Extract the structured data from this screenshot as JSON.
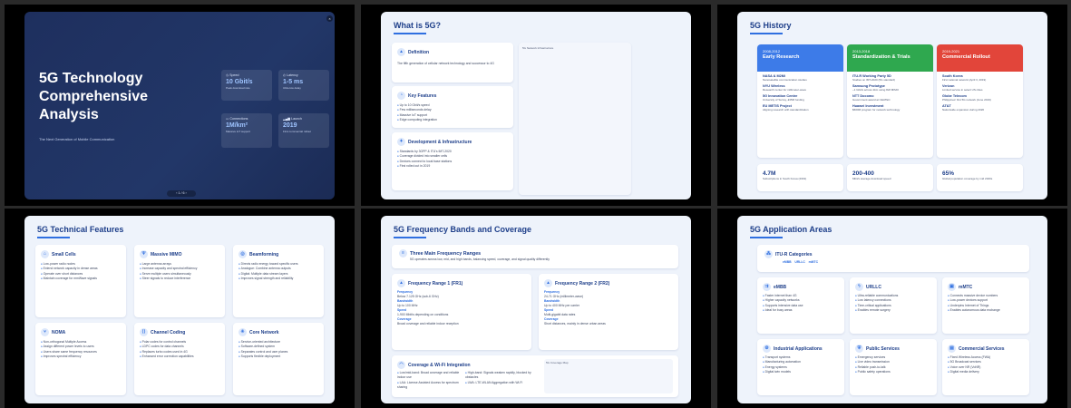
{
  "slides": {
    "s1": {
      "title_l1": "5G Technology",
      "title_l2": "Comprehensive",
      "title_l3": "Analysis",
      "subtitle": "The Next Generation of Mobile Communication",
      "stats": [
        {
          "label": "Speed",
          "value": "10 Gbit/s",
          "desc": "Peak download rate"
        },
        {
          "label": "Latency",
          "value": "1-5 ms",
          "desc": "Ultra-low delay"
        },
        {
          "label": "Connections",
          "value": "1M/km²",
          "desc": "Massive IoT support"
        },
        {
          "label": "Launch",
          "value": "2019",
          "desc": "First commercial rollout"
        }
      ],
      "pager": "1 / 6",
      "close": "×"
    },
    "s2": {
      "title": "What is 5G?",
      "definition_title": "Definition",
      "definition_text": "The fifth generation of cellular network technology and successor to 4G",
      "features_title": "Key Features",
      "features": [
        "Up to 10 Gbit/s speed",
        "Few milliseconds delay",
        "Massive IoT support",
        "Edge computing integration"
      ],
      "dev_title": "Development & Infrastructure",
      "dev_items": [
        "Standards by 3GPP & ITU's IMT-2020",
        "Coverage divided into smaller cells",
        "Devices connect to local base stations",
        "First rolled out in 2019"
      ],
      "image_caption": "5G Network Infrastructure"
    },
    "s3": {
      "title": "5G History",
      "columns": [
        {
          "years": "2008-2012",
          "name": "Early Research",
          "color": "#3d7be8",
          "items": [
            {
              "t": "NASA & M2Mi",
              "d": "Nanosatellite communication studies"
            },
            {
              "t": "NYU Wireless",
              "d": "Research center for millimeter-wave"
            },
            {
              "t": "5G Innovation Centre",
              "d": "University of Surrey, £35M funding"
            },
            {
              "t": "EU METIS Project",
              "d": "Aligning research with standardization"
            }
          ]
        },
        {
          "years": "2013-2018",
          "name": "Standardization & Trials",
          "color": "#2fa84f",
          "items": [
            {
              "t": "ITU-R Working Party 5D",
              "d": "Studies on IMT-2020 (5G standard)"
            },
            {
              "t": "Samsung Prototype",
              "d": "~1 Gbit/s across 2km using 8x8 MIMO"
            },
            {
              "t": "NTT Docomo",
              "d": "Government award at CEATEC"
            },
            {
              "t": "Huawei Investment",
              "d": "$600M program for network technology"
            }
          ]
        },
        {
          "years": "2019-2021",
          "name": "Commercial Rollout",
          "color": "#e2453a",
          "items": [
            {
              "t": "South Korea",
              "d": "First national network (April 3, 2019)"
            },
            {
              "t": "Verizon",
              "d": "Limited service in select US cities"
            },
            {
              "t": "Globe Telecom",
              "d": "Philippines' first 5G network (June 2019)"
            },
            {
              "t": "AT&T",
              "d": "Nationwide expansion during 2020"
            }
          ]
        }
      ],
      "stats": [
        {
          "v": "4.7M",
          "d": "Subscriptions in South Korea (2019)"
        },
        {
          "v": "200-400",
          "d": "Mbit/s average download speed"
        },
        {
          "v": "65%",
          "d": "Global population coverage by mid 2020s"
        }
      ]
    },
    "s4": {
      "title": "5G Technical Features",
      "cards": [
        {
          "t": "Small Cells",
          "items": [
            "Low-power radio nodes",
            "Extend network capacity in dense areas",
            "Operate over short distances",
            "Maintain coverage for mmWave signals"
          ]
        },
        {
          "t": "Massive MIMO",
          "items": [
            "Large antenna arrays",
            "Increase capacity and spectral efficiency",
            "Serve multiple users simultaneously",
            "Steer signals to reduce interference"
          ]
        },
        {
          "t": "Beamforming",
          "items": [
            "Directs radio energy toward specific users",
            "Analogue: Combine antenna outputs",
            "Digital: Multiple data stream layers",
            "Improves signal strength and reliability"
          ]
        },
        {
          "t": "NOMA",
          "items": [
            "Non-orthogonal Multiple Access",
            "Assign different power levels to users",
            "Users share same frequency resources",
            "Improves spectral efficiency"
          ]
        },
        {
          "t": "Channel Coding",
          "items": [
            "Polar codes for control channels",
            "LDPC codes for data channels",
            "Replaces turbo codes used in 4G",
            "Enhanced error correction capabilities"
          ]
        },
        {
          "t": "Core Network",
          "items": [
            "Service-oriented architecture",
            "Software-defined system",
            "Separates control and user planes",
            "Supports flexible deployment"
          ]
        }
      ]
    },
    "s5": {
      "title": "5G Frequency Bands and Coverage",
      "banner_title": "Three Main Frequency Ranges",
      "banner_text": "5G operates across low, mid, and high bands, balancing speed, coverage, and signal quality differently",
      "fr1_title": "Frequency Range 1 (FR1)",
      "fr1": [
        {
          "k": "Frequency",
          "v": "Below 7.125 GHz (sub-6 GHz)"
        },
        {
          "k": "Bandwidth",
          "v": "Up to 100 MHz"
        },
        {
          "k": "Speed",
          "v": "1-900 Mbit/s depending on conditions"
        },
        {
          "k": "Coverage",
          "v": "Broad coverage and reliable indoor reception"
        }
      ],
      "fr2_title": "Frequency Range 2 (FR2)",
      "fr2": [
        {
          "k": "Frequency",
          "v": "24-71 GHz (millimeter-wave)"
        },
        {
          "k": "Bandwidth",
          "v": "Up to 400 MHz per carrier"
        },
        {
          "k": "Speed",
          "v": "Multi-gigabit data rates"
        },
        {
          "k": "Coverage",
          "v": "Short distances, mainly in dense urban areas"
        }
      ],
      "cov_title": "Coverage & Wi-Fi Integration",
      "cov_items": [
        "Low/mid-band: Broad coverage and reliable indoor use",
        "High-band: Signals weaken rapidly, blocked by obstacles",
        "LAA: License Assisted Access for spectrum sharing",
        "LWA: LTE-WLAN Aggregation with Wi-Fi"
      ],
      "map_caption": "5G Coverage Map"
    },
    "s6": {
      "title": "5G Application Areas",
      "itu_title": "ITU-R Categories",
      "itu_tags": [
        "eMBB",
        "URLLC",
        "mMTC"
      ],
      "cards": [
        {
          "t": "eMBB",
          "items": [
            "Faster internet than 4G",
            "Higher capacity networks",
            "Supports intensive data use",
            "Ideal for busy areas"
          ]
        },
        {
          "t": "URLLC",
          "items": [
            "Ultra-reliable communications",
            "Low latency connections",
            "Time-critical applications",
            "Enables remote surgery"
          ]
        },
        {
          "t": "mMTC",
          "items": [
            "Connects massive device numbers",
            "Low-power devices support",
            "Underpins Internet of Things",
            "Enables autonomous data exchange"
          ]
        },
        {
          "t": "Industrial Applications",
          "items": [
            "Transport systems",
            "Manufacturing automation",
            "Energy systems",
            "Digital twin models"
          ]
        },
        {
          "t": "Public Services",
          "items": [
            "Emergency services",
            "Live video transmission",
            "Reliable push-to-talk",
            "Public safety operations"
          ]
        },
        {
          "t": "Commercial Services",
          "items": [
            "Fixed Wireless Access (FWA)",
            "5G Broadcast services",
            "Voice over NR (VoNR)",
            "Digital media delivery"
          ]
        }
      ]
    }
  }
}
